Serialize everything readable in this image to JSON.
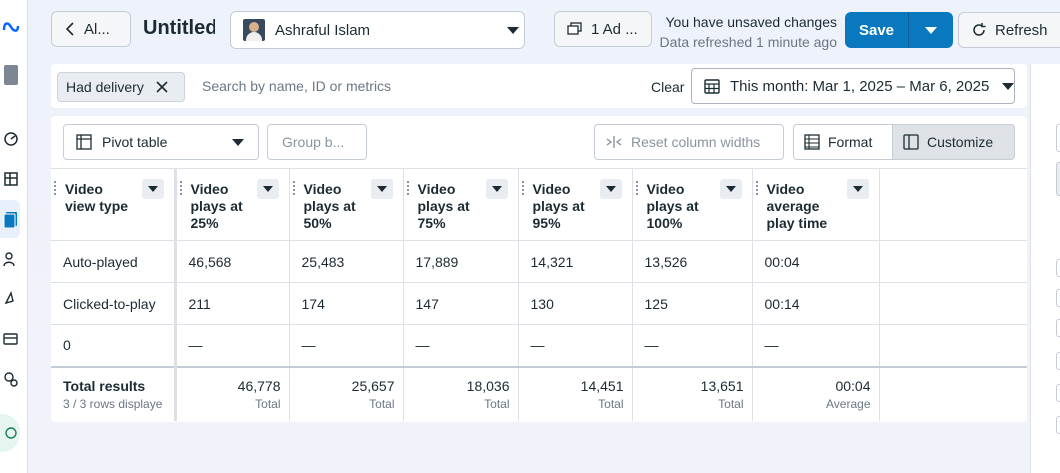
{
  "header": {
    "back_label": "Al...",
    "title": "Untitled",
    "account_name": "Ashraful Islam",
    "ads_selector": "1 Ad ...",
    "status_line": "You have unsaved changes",
    "refresh_status": "Data refreshed 1 minute ago",
    "save_label": "Save",
    "refresh_label": "Refresh"
  },
  "filters": {
    "chip_label": "Had delivery",
    "search_placeholder": "Search by name, ID or metrics",
    "clear_label": "Clear",
    "date_range": "This month: Mar 1, 2025 – Mar 6, 2025"
  },
  "toolbar": {
    "view_label": "Pivot table",
    "groupby_label": "Group b...",
    "reset_label": "Reset column widths",
    "format_label": "Format",
    "customize_label": "Customize"
  },
  "table": {
    "headers": [
      "Video view type",
      "Video plays at 25%",
      "Video plays at 50%",
      "Video plays at 75%",
      "Video plays at 95%",
      "Video plays at 100%",
      "Video average play time"
    ],
    "rows": [
      [
        "Auto-played",
        "46,568",
        "25,483",
        "17,889",
        "14,321",
        "13,526",
        "00:04"
      ],
      [
        "Clicked-to-play",
        "211",
        "174",
        "147",
        "130",
        "125",
        "00:14"
      ],
      [
        "0",
        "—",
        "—",
        "—",
        "—",
        "—",
        "—"
      ]
    ],
    "total": {
      "label": "Total results",
      "sublabel": "3 / 3 rows displaye",
      "values": [
        "46,778",
        "25,657",
        "18,036",
        "14,451",
        "13,651",
        "00:04"
      ],
      "sublabels": [
        "Total",
        "Total",
        "Total",
        "Total",
        "Total",
        "Average"
      ]
    }
  },
  "colors": {
    "accent": "#0a78be",
    "page_bg": "#eef2fb"
  },
  "icons": [
    "meta-logo",
    "profile-icon",
    "dashboard-icon",
    "table-icon",
    "reports-icon",
    "audience-icon",
    "campaign-icon",
    "billing-icon",
    "settings-icon",
    "help-icon"
  ]
}
